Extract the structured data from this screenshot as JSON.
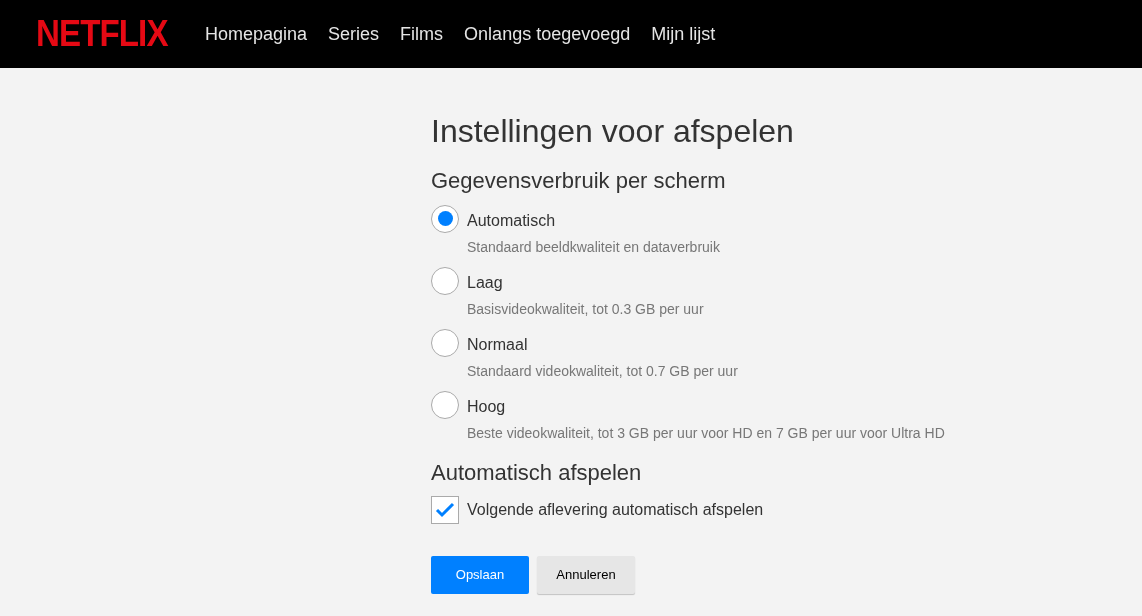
{
  "header": {
    "logo": "NETFLIX",
    "nav": [
      {
        "label": "Homepagina"
      },
      {
        "label": "Series"
      },
      {
        "label": "Films"
      },
      {
        "label": "Onlangs toegevoegd"
      },
      {
        "label": "Mijn lijst"
      }
    ]
  },
  "title": "Instellingen voor afspelen",
  "data_usage": {
    "heading": "Gegevensverbruik per scherm",
    "options": [
      {
        "label": "Automatisch",
        "description": "Standaard beeldkwaliteit en dataverbruik",
        "selected": true
      },
      {
        "label": "Laag",
        "description": "Basisvideokwaliteit, tot 0.3 GB per uur",
        "selected": false
      },
      {
        "label": "Normaal",
        "description": "Standaard videokwaliteit, tot 0.7 GB per uur",
        "selected": false
      },
      {
        "label": "Hoog",
        "description": "Beste videokwaliteit, tot 3 GB per uur voor HD en 7 GB per uur voor Ultra HD",
        "selected": false
      }
    ]
  },
  "autoplay": {
    "heading": "Automatisch afspelen",
    "options": [
      {
        "label": "Volgende aflevering automatisch afspelen",
        "checked": true
      }
    ]
  },
  "buttons": [
    {
      "label": "Opslaan",
      "kind": "primary"
    },
    {
      "label": "Annuleren",
      "kind": "secondary"
    }
  ]
}
